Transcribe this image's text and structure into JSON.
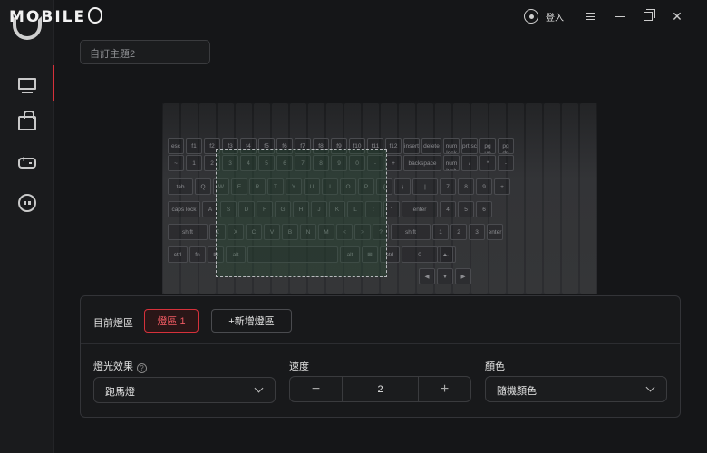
{
  "app": {
    "logo_text": "MOBILE",
    "login_label": "登入"
  },
  "theme": {
    "name": "自訂主題2"
  },
  "lighting": {
    "current_zone_label": "目前燈區",
    "zone_button": "燈區 1",
    "add_zone_button": "+新增燈區",
    "effect_label": "燈光效果",
    "help_icon_text": "?",
    "effect_value": "跑馬燈",
    "speed_label": "速度",
    "speed_minus": "−",
    "speed_value": "2",
    "speed_plus": "+",
    "color_label": "顏色",
    "color_value": "隨機顏色"
  },
  "colors": {
    "accent": "#d6313b",
    "background": "#151618",
    "selection": "#2a4a36"
  },
  "icons": {
    "sidebar": [
      "monitor-icon",
      "shopping-bag-icon",
      "gamepad-icon",
      "ghost-icon"
    ],
    "titlebar": [
      "user-icon",
      "menu-icon",
      "minimize-icon",
      "maximize-icon",
      "close-icon"
    ]
  },
  "keyboard": {
    "row_fn": [
      "esc",
      "f1",
      "f2",
      "f3",
      "f4",
      "f5",
      "f6",
      "f7",
      "f8",
      "f9",
      "f10",
      "f11",
      "f12",
      "insert",
      "delete",
      "num lock",
      "prt sc",
      "pg up",
      "pg dn"
    ],
    "row_num": [
      "~",
      "1",
      "2",
      "3",
      "4",
      "5",
      "6",
      "7",
      "8",
      "9",
      "0",
      "-",
      "+",
      "backspace",
      "num lock",
      "/",
      "*",
      "-"
    ],
    "row_q": [
      "tab",
      "Q",
      "W",
      "E",
      "R",
      "T",
      "Y",
      "U",
      "I",
      "O",
      "P",
      "{",
      "}",
      "|",
      "7",
      "8",
      "9",
      "+"
    ],
    "row_a": [
      "caps lock",
      "A",
      "S",
      "D",
      "F",
      "G",
      "H",
      "J",
      "K",
      "L",
      ":",
      "\"",
      "enter",
      "4",
      "5",
      "6"
    ],
    "row_z": [
      "shift",
      "Z",
      "X",
      "C",
      "V",
      "B",
      "N",
      "M",
      "<",
      ">",
      "?",
      "shift",
      "1",
      "2",
      "3",
      "enter"
    ],
    "row_ctrl": [
      "ctrl",
      "fn",
      "⊞",
      "alt",
      "",
      "alt",
      "⊞",
      "ctrl",
      "0",
      "."
    ]
  }
}
